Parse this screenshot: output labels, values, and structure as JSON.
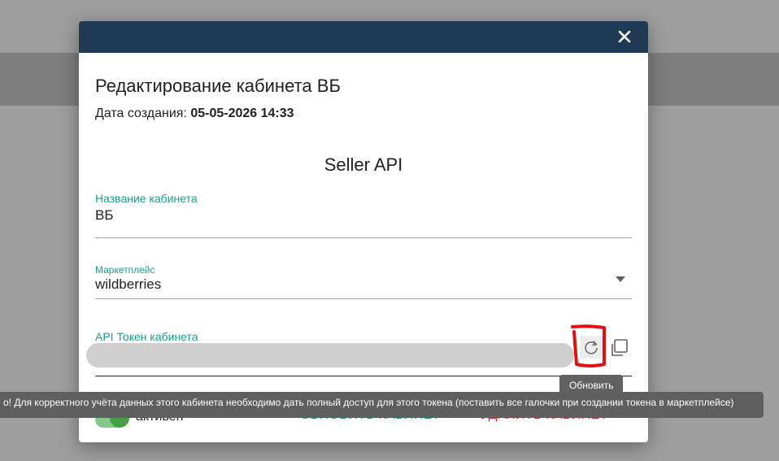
{
  "modal": {
    "title": "Редактирование кабинета ВБ",
    "created_label": "Дата создания:",
    "created_value": "05-05-2026 14:33",
    "section_title": "Seller API",
    "name_field": {
      "label": "Название кабинета",
      "value": "ВБ"
    },
    "marketplace_field": {
      "label": "Маркетплейс",
      "value": "wildberries"
    },
    "token_field": {
      "label": "API Токен кабинета",
      "value": ""
    },
    "active_toggle": {
      "label": "активен",
      "on": true
    },
    "update_button": "ОБНОВИТЬ КАБИНЕТ",
    "delete_button": "УДАЛИТЬ КАБИНЕТ"
  },
  "tooltip": {
    "text": "Обновить"
  },
  "snackbar": {
    "text": "о! Для корректного учёта данных этого кабинета необходимо дать полный доступ для этого токена (поставить все галочки при создании токена в маркетплейсе)"
  },
  "colors": {
    "header": "#1f3a55",
    "accent": "#1a9e8a",
    "danger": "#d32f2f",
    "toggle": "#43a047"
  }
}
